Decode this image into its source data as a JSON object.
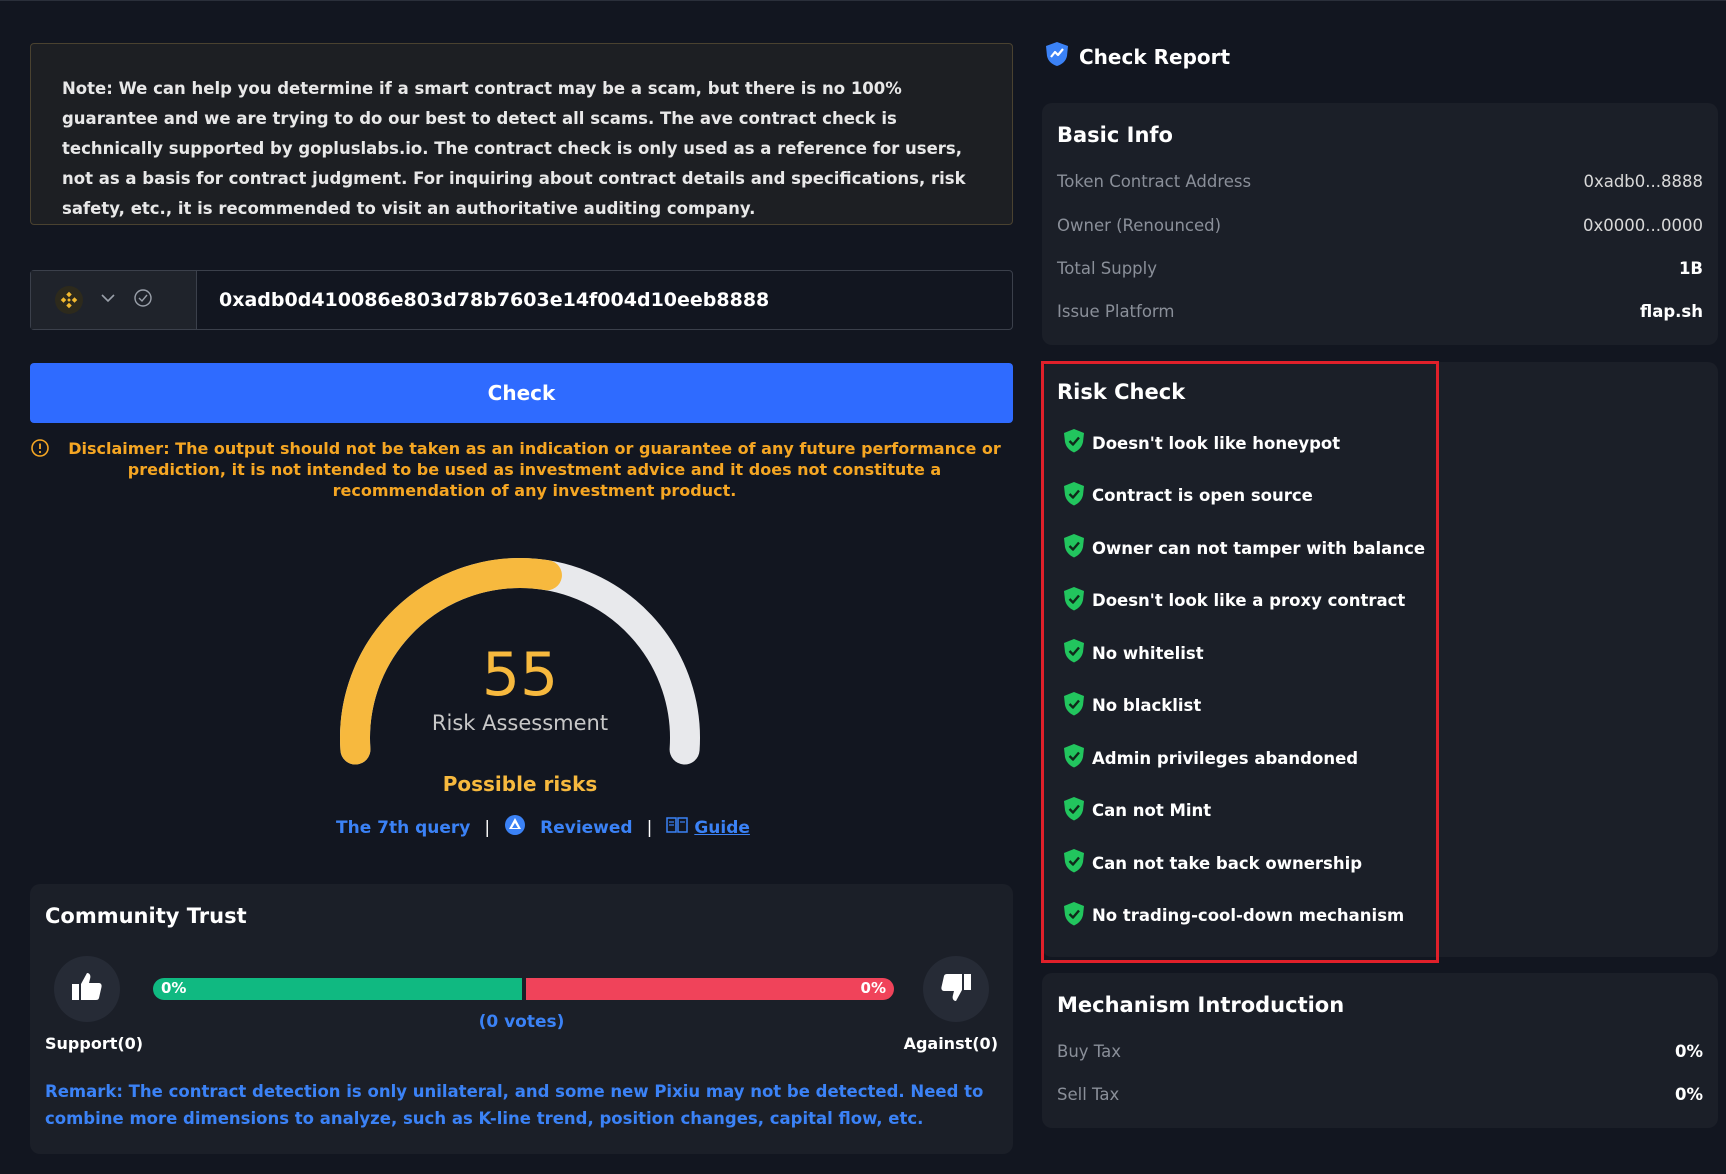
{
  "note": "Note: We can help you determine if a smart contract may be a scam, but there is no 100% guarantee and we are trying to do our best to detect all scams. The ave contract check is technically supported by gopluslabs.io. The contract check is only used as a reference for users, not as a basis for contract judgment. For inquiring about contract details and specifications, risk safety, etc., it is recommended to visit an authoritative auditing company.",
  "search": {
    "chain_icon": "bnb-chain-icon",
    "address": "0xadb0d410086e803d78b7603e14f004d10eeb8888",
    "check_label": "Check"
  },
  "disclaimer": "Disclaimer: The output should not be taken as an indication or guarantee of any future performance or prediction, it is not intended to be used as investment advice and it does not constitute a recommendation of any investment product.",
  "assessment": {
    "score": "55",
    "score_value": 55,
    "label": "Risk Assessment",
    "status": "Possible risks",
    "query": "The 7th query",
    "reviewed": "Reviewed",
    "guide": "Guide"
  },
  "community": {
    "title": "Community Trust",
    "support_pct": "0%",
    "against_pct": "0%",
    "support_share": 0.5,
    "votes": "(0 votes)",
    "support_label": "Support(0)",
    "against_label": "Against(0)",
    "remark": "Remark: The contract detection is only unilateral, and some new Pixiu may not be detected. Need to combine more dimensions to analyze, such as K-line trend, position changes, capital flow, etc."
  },
  "report": {
    "title": "Check Report",
    "basic_info": {
      "title": "Basic Info",
      "rows": [
        {
          "key": "Token Contract Address",
          "value": "0xadb0...8888"
        },
        {
          "key": "Owner (Renounced)",
          "value": "0x0000...0000"
        },
        {
          "key": "Total Supply",
          "value": "1B"
        },
        {
          "key": "Issue Platform",
          "value": "flap.sh"
        }
      ]
    },
    "risk_check": {
      "title": "Risk Check",
      "items": [
        "Doesn't look like honeypot",
        "Contract is open source",
        "Owner can not tamper with balance",
        "Doesn't look like a proxy contract",
        "No whitelist",
        "No blacklist",
        "Admin privileges abandoned",
        "Can not Mint",
        "Can not take back ownership",
        "No trading-cool-down mechanism"
      ]
    },
    "mechanism": {
      "title": "Mechanism Introduction",
      "rows": [
        {
          "key": "Buy Tax",
          "value": "0%"
        },
        {
          "key": "Sell Tax",
          "value": "0%"
        }
      ]
    }
  },
  "colors": {
    "background": "#121620",
    "panel": "#1b1f28",
    "accent": "#2f6bff",
    "warning": "#f5a623",
    "gauge_fill": "#f7b93e",
    "support": "#10b981",
    "against": "#f0435a",
    "highlight": "#e0202a",
    "safe": "#22c55e"
  }
}
